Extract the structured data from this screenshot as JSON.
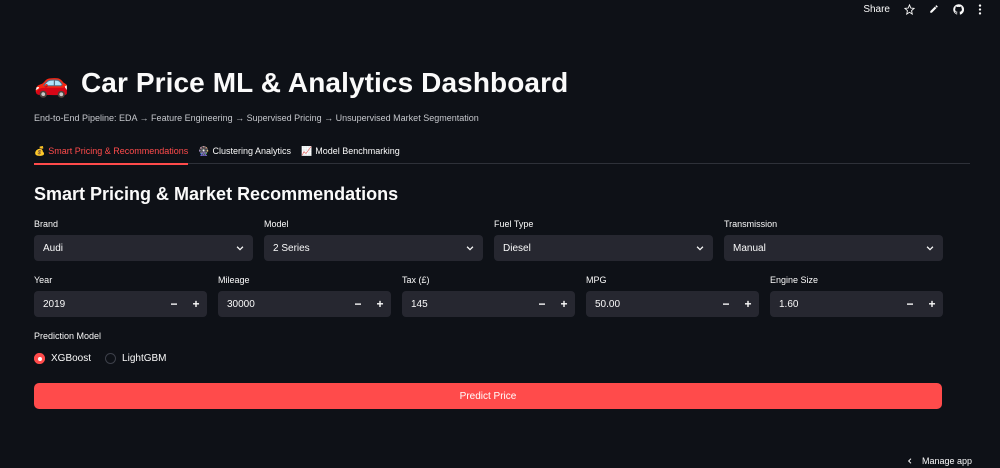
{
  "toolbar": {
    "share_label": "Share",
    "icons": [
      "star-icon",
      "pencil-icon",
      "github-icon",
      "more-vertical-icon"
    ]
  },
  "header": {
    "emoji": "🚗",
    "title": "Car Price ML & Analytics Dashboard",
    "subtitle": "End-to-End Pipeline: EDA → Feature Engineering → Supervised Pricing → Unsupervised Market Segmentation"
  },
  "tabs": [
    {
      "icon": "💰",
      "label": "Smart Pricing & Recommendations",
      "active": true
    },
    {
      "icon": "🎡",
      "label": "Clustering Analytics",
      "active": false
    },
    {
      "icon": "📈",
      "label": "Model Benchmarking",
      "active": false
    }
  ],
  "section_title": "Smart Pricing & Market Recommendations",
  "selects": [
    {
      "label": "Brand",
      "value": "Audi"
    },
    {
      "label": "Model",
      "value": "2 Series"
    },
    {
      "label": "Fuel Type",
      "value": "Diesel"
    },
    {
      "label": "Transmission",
      "value": "Manual"
    }
  ],
  "numbers": [
    {
      "label": "Year",
      "value": "2019"
    },
    {
      "label": "Mileage",
      "value": "30000"
    },
    {
      "label": "Tax (£)",
      "value": "145"
    },
    {
      "label": "MPG",
      "value": "50.00"
    },
    {
      "label": "Engine Size",
      "value": "1.60"
    }
  ],
  "stepper": {
    "minus": "−",
    "plus": "+"
  },
  "prediction": {
    "label": "Prediction Model",
    "options": [
      "XGBoost",
      "LightGBM"
    ],
    "selected": "XGBoost"
  },
  "predict_button": "Predict Price",
  "manage_app": "Manage app",
  "colors": {
    "background": "#0e1117",
    "widget": "#262730",
    "accent": "#ff4b4b",
    "text": "#fafafa"
  }
}
